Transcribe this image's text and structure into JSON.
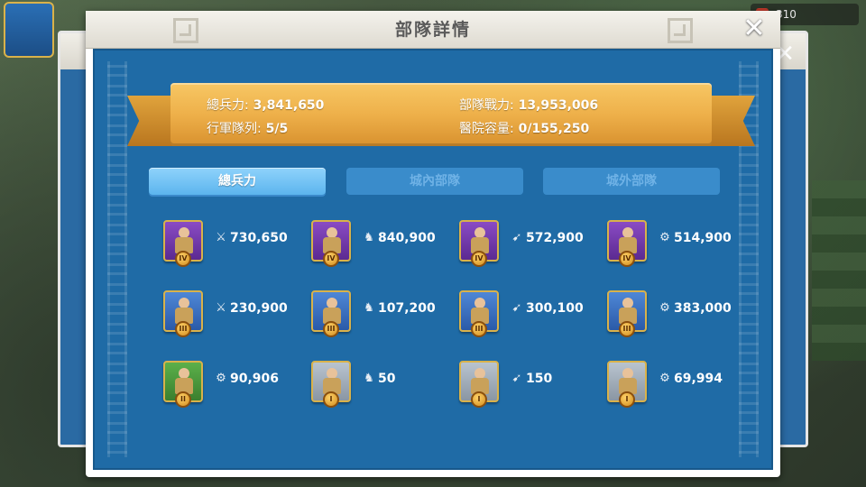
{
  "background": {
    "resource_value": "310"
  },
  "dialog": {
    "title": "部隊詳情",
    "close_glyph": "✕"
  },
  "summary": {
    "total_troops_label": "總兵力:",
    "total_troops_value": "3,841,650",
    "march_queue_label": "行軍隊列:",
    "march_queue_value": "5/5",
    "troop_power_label": "部隊戰力:",
    "troop_power_value": "13,953,006",
    "hospital_label": "醫院容量:",
    "hospital_value": "0/155,250"
  },
  "tabs": [
    {
      "label": "總兵力",
      "active": true
    },
    {
      "label": "城內部隊",
      "active": false
    },
    {
      "label": "城外部隊",
      "active": false
    }
  ],
  "troops": [
    {
      "unit": "infantry",
      "tier": "IV",
      "icon": "sword-icon",
      "glyph": "⚔",
      "count": "730,650"
    },
    {
      "unit": "cavalry",
      "tier": "IV",
      "icon": "horse-icon",
      "glyph": "♞",
      "count": "840,900"
    },
    {
      "unit": "archer",
      "tier": "IV",
      "icon": "bow-icon",
      "glyph": "➹",
      "count": "572,900"
    },
    {
      "unit": "siege",
      "tier": "IV",
      "icon": "siege-icon",
      "glyph": "⚙",
      "count": "514,900"
    },
    {
      "unit": "infantry",
      "tier": "III",
      "icon": "sword-icon",
      "glyph": "⚔",
      "count": "230,900"
    },
    {
      "unit": "cavalry",
      "tier": "III",
      "icon": "horse-icon",
      "glyph": "♞",
      "count": "107,200"
    },
    {
      "unit": "archer",
      "tier": "III",
      "icon": "bow-icon",
      "glyph": "➹",
      "count": "300,100"
    },
    {
      "unit": "siege",
      "tier": "III",
      "icon": "siege-icon",
      "glyph": "⚙",
      "count": "383,000"
    },
    {
      "unit": "siege",
      "tier": "II",
      "icon": "siege-icon",
      "glyph": "⚙",
      "count": "90,906"
    },
    {
      "unit": "cavalry",
      "tier": "I",
      "icon": "horse-icon",
      "glyph": "♞",
      "count": "50"
    },
    {
      "unit": "archer",
      "tier": "I",
      "icon": "bow-icon",
      "glyph": "➹",
      "count": "150"
    },
    {
      "unit": "siege",
      "tier": "I",
      "icon": "siege-icon",
      "glyph": "⚙",
      "count": "69,994"
    }
  ],
  "colors": {
    "panel_blue": "#1f6ba6",
    "ribbon_gold": "#eeb04a",
    "tab_active": "#5cb5ee",
    "tab_inactive": "#3a8ccb"
  }
}
